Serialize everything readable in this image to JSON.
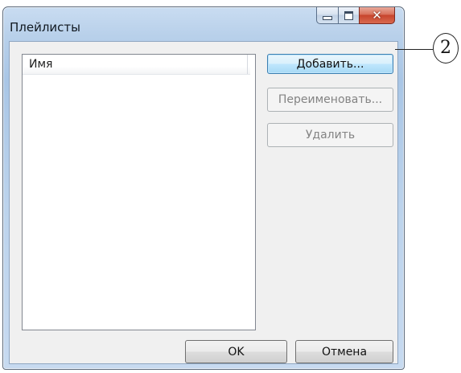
{
  "window": {
    "title": "Плейлисты",
    "close_glyph": "✕"
  },
  "list": {
    "column_header": "Имя",
    "items": []
  },
  "buttons": {
    "add": "Добавить...",
    "rename": "Переименовать...",
    "delete": "Удалить",
    "ok": "OK",
    "cancel": "Отмена"
  },
  "callout": {
    "label": "2"
  },
  "colors": {
    "title_bar": "#b8d0ea",
    "close_button": "#c7442d",
    "client_background": "#f0f0f0",
    "default_button": "#bee6fd"
  },
  "icons": {
    "minimize": "minimize-icon",
    "maximize": "maximize-icon",
    "close": "close-icon"
  }
}
